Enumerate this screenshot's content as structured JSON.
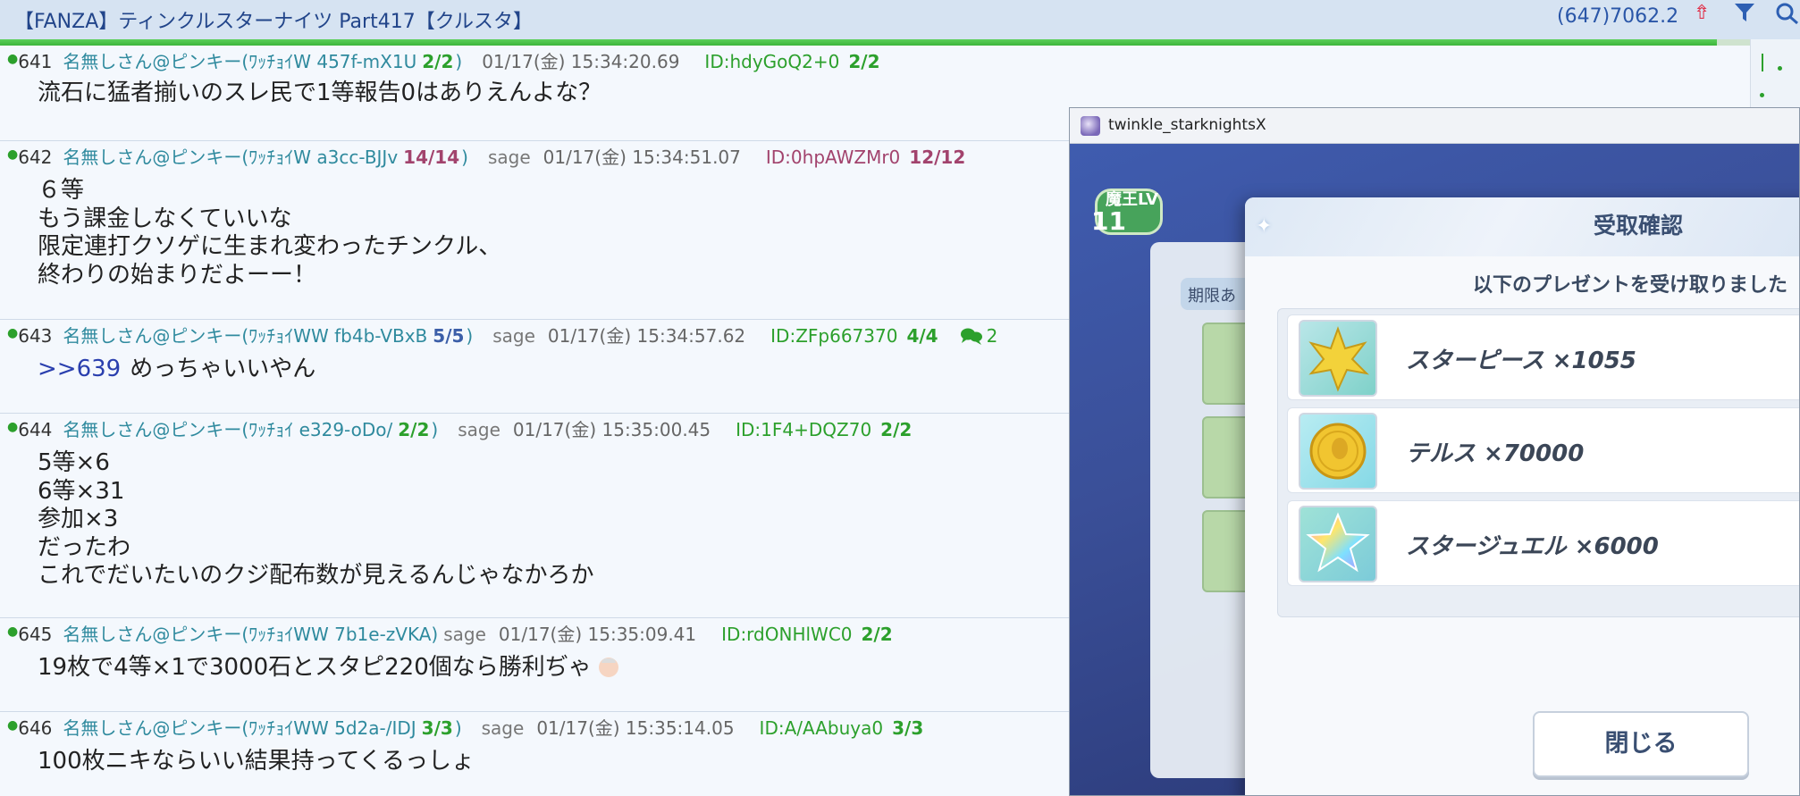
{
  "thread": {
    "title": "【FANZA】ティンクルスターナイツ Part417【クルスタ】",
    "count": "(647)7062.2",
    "colors": {
      "accent": "#2ca02c",
      "link": "#2a3fae",
      "header_bg": "#d6e3f2"
    }
  },
  "posts": [
    {
      "num": "641",
      "name": "名無しさん@ピンキー(ﾜｯﾁｮｲW 457f-mX1U",
      "count": "2/2",
      "paren": ")",
      "sage": "",
      "date": "01/17(金) 15:34:20.69",
      "id": "ID:hdyGoQ2+0",
      "ratio": "2/2",
      "replies": "",
      "lines": [
        "流石に猛者揃いのスレ民で1等報告0はありえんよな？"
      ]
    },
    {
      "num": "642",
      "name": "名無しさん@ピンキー(ﾜｯﾁｮｲW a3cc-BJJv",
      "count": "14/14",
      "paren": ")",
      "sage": "sage",
      "date": "01/17(金) 15:34:51.07",
      "id": "ID:0hpAWZMr0",
      "ratio": "12/12",
      "replies": "",
      "lines": [
        "６等",
        "もう課金しなくていいな",
        "限定連打クソゲに生まれ変わったチンクル、",
        "終わりの始まりだよーー！"
      ]
    },
    {
      "num": "643",
      "name": "名無しさん@ピンキー(ﾜｯﾁｮｲWW fb4b-VBxB",
      "count": "5/5",
      "paren": ")",
      "sage": "sage",
      "date": "01/17(金) 15:34:57.62",
      "id": "ID:ZFp667370",
      "ratio": "4/4",
      "replies": "2",
      "anchor": ">>639",
      "lines": [
        "めっちゃいいやん"
      ]
    },
    {
      "num": "644",
      "name": "名無しさん@ピンキー(ﾜｯﾁｮｲ e329-oDo/",
      "count": "2/2",
      "paren": ")",
      "sage": "sage",
      "date": "01/17(金) 15:35:00.45",
      "id": "ID:1F4+DQZ70",
      "ratio": "2/2",
      "replies": "",
      "lines": [
        "5等×6",
        "6等×31",
        "参加×3",
        "だったわ",
        "これでだいたいのクジ配布数が見えるんじゃなかろか"
      ]
    },
    {
      "num": "645",
      "name": "名無しさん@ピンキー(ﾜｯﾁｮｲWW 7b1e-zVKA)",
      "count": "",
      "paren": "",
      "sage": "sage",
      "date": "01/17(金) 15:35:09.41",
      "id": "ID:rdONHlWC0",
      "ratio": "2/2",
      "replies": "",
      "lines": [
        "19枚で4等×1で3000石とスタピ220個なら勝利ぢゃ"
      ]
    },
    {
      "num": "646",
      "name": "名無しさん@ピンキー(ﾜｯﾁｮｲWW 5d2a-/IDJ",
      "count": "3/3",
      "paren": ")",
      "sage": "sage",
      "date": "01/17(金) 15:35:14.05",
      "id": "ID:A/AAbuya0",
      "ratio": "3/3",
      "replies": "",
      "lines": [
        "100枚ニキならいい結果持ってくるっしょ"
      ]
    }
  ],
  "scroll_progress": 0.98,
  "game": {
    "window_title": "twinkle_starknightsX",
    "bg_labels": {
      "level": "魔王LV",
      "level_value": "11",
      "tab": "期限あ"
    },
    "modal": {
      "title": "受取確認",
      "subtitle": "以下のプレゼントを受け取りました",
      "items": [
        {
          "label": "スターピース ×1055",
          "icon": "star-piece-icon"
        },
        {
          "label": "テルス ×70000",
          "icon": "tells-coin-icon"
        },
        {
          "label": "スタージュエル ×6000",
          "icon": "star-jewel-icon"
        }
      ],
      "close_label": "閉じる"
    }
  }
}
